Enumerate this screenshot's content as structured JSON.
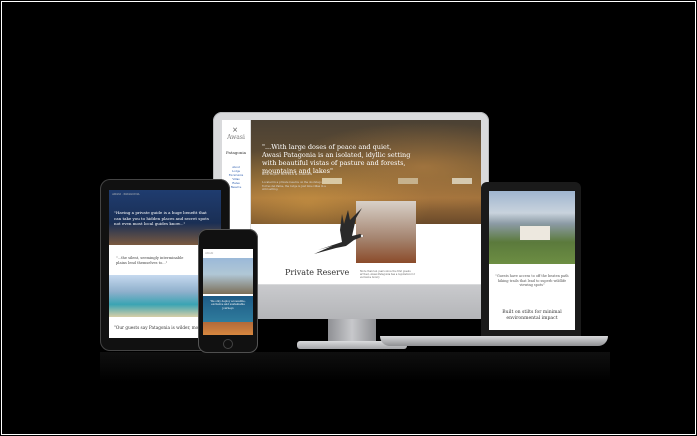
{
  "imac": {
    "hero_quote": "\"...With large doses of peace and quiet, Awasi Patagonia is an isolated, idyllic setting with beautiful vistas of pasture and forests, mountains and lakes\"",
    "hero_source": "BOUTIQUE HOTELS & LODGES",
    "hero_body": "Located in a private reserve on the doorstep of Torres del Paine, the lodge is just nine villas in a wild setting.",
    "section_title": "Private Reserve",
    "section_body": "More than ten years since the first guests arrived, Awasi Patagonia has a reputation for exclusive luxury.",
    "side_logo": "Awasi",
    "side_title": "Patagonia",
    "side_menu": [
      "About",
      "Lodge",
      "Excursions",
      "Villas",
      "Rates",
      "Reserve"
    ]
  },
  "laptop": {
    "quote": "\"Guests have access to off the beaten path hiking trails that lead to superb wildlife viewing spots\"",
    "heading": "Built on stilts for minimal environmental impact"
  },
  "ipad": {
    "header": "AWASI · PATAGONIA",
    "quote1": "\"Having a private guide is a huge benefit that can take you to hidden places and secret spots not even most local guides know...\"",
    "quote2": "\"...the silent, seemingly interminable plains lend themselves to...\"",
    "quote3": "\"Our guests say Patagonia is wilder, more"
  },
  "iphone": {
    "header": "AWASI",
    "caption": "We only deploy accessible, exclusive and sustainable journeys"
  }
}
